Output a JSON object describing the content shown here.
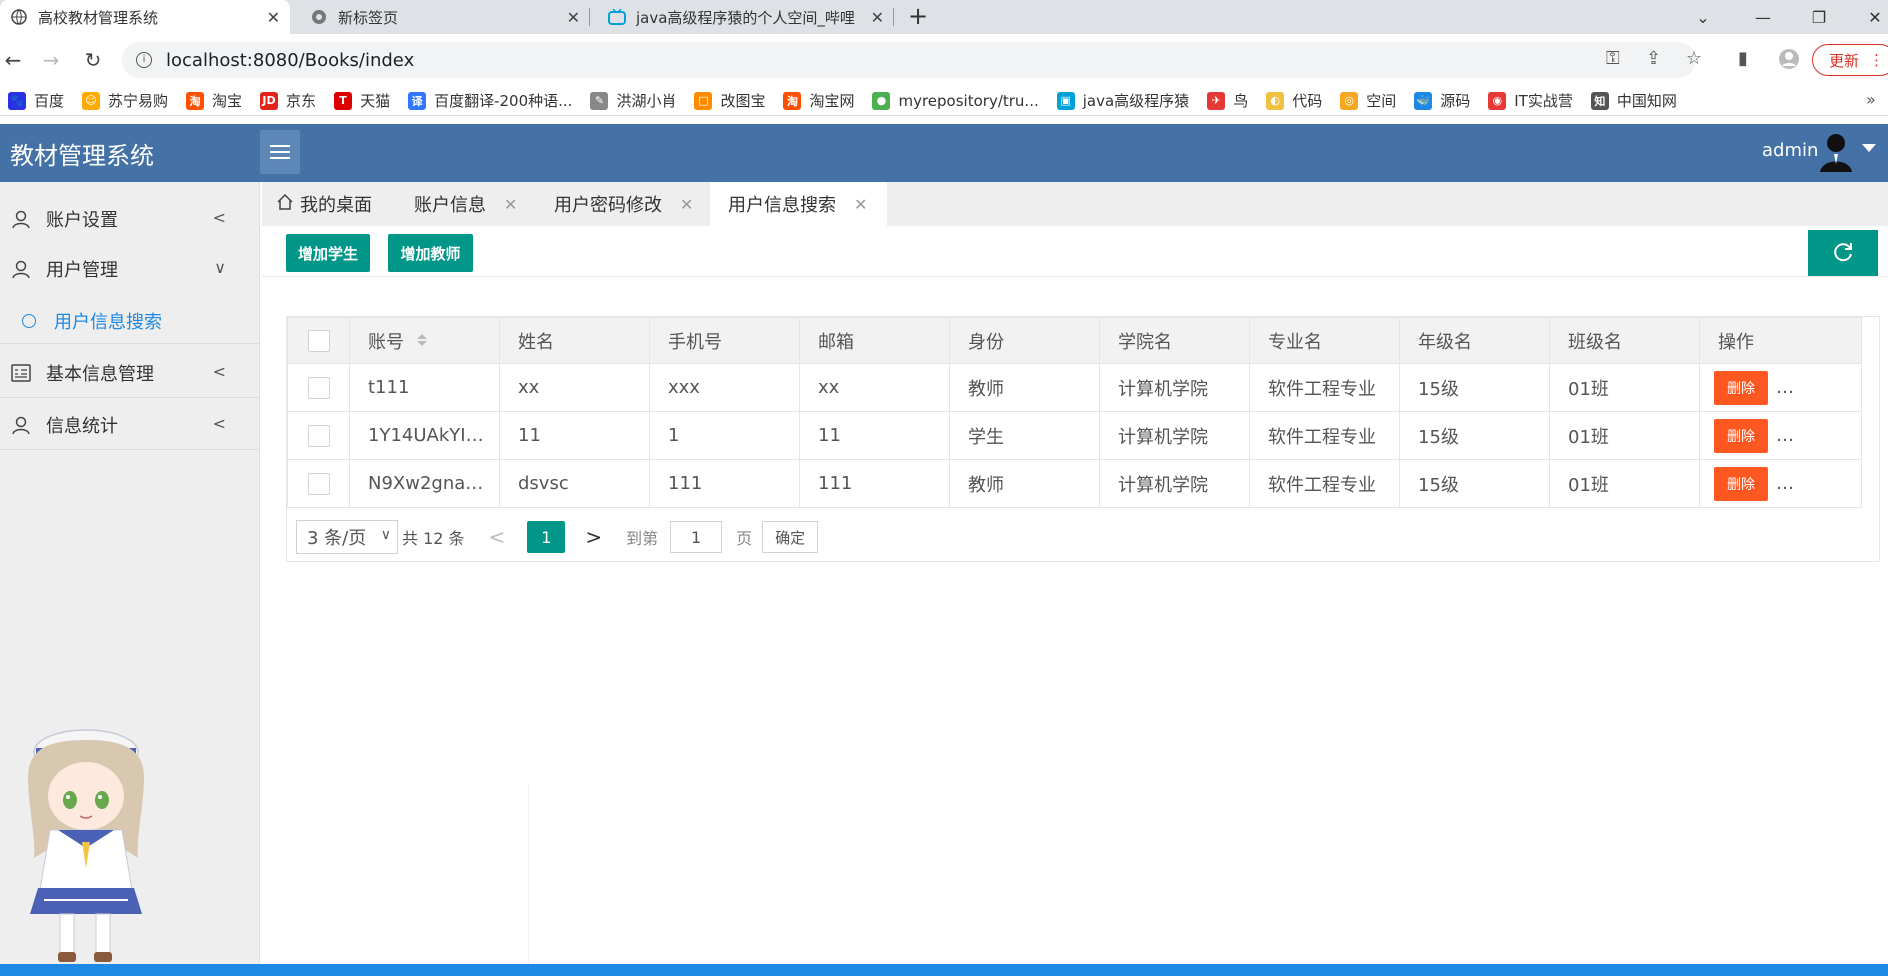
{
  "browser": {
    "tabs": [
      {
        "title": "高校教材管理系统",
        "icon": "globe-icon"
      },
      {
        "title": "新标签页",
        "icon": "chrome-icon"
      },
      {
        "title": "java高级程序猿的个人空间_哔哩",
        "icon": "bilibili-icon"
      }
    ],
    "url": "localhost:8080/Books/index",
    "update_label": "更新",
    "bookmarks": [
      {
        "label": "百度",
        "color": "#2932e1",
        "glyph": "🐾"
      },
      {
        "label": "苏宁易购",
        "color": "#ffaa00",
        "glyph": "☺"
      },
      {
        "label": "淘宝",
        "color": "#ff5000",
        "glyph": "淘"
      },
      {
        "label": "京东",
        "color": "#e1251b",
        "glyph": "JD"
      },
      {
        "label": "天猫",
        "color": "#d00",
        "glyph": "T"
      },
      {
        "label": "百度翻译-200种语...",
        "color": "#3377ff",
        "glyph": "译"
      },
      {
        "label": "洪湖小肖",
        "color": "#888",
        "glyph": "✎"
      },
      {
        "label": "改图宝",
        "color": "#ff8c00",
        "glyph": "□"
      },
      {
        "label": "淘宝网",
        "color": "#ff5000",
        "glyph": "淘"
      },
      {
        "label": "myrepository/tru...",
        "color": "#4caf50",
        "glyph": "●"
      },
      {
        "label": "java高级程序猿",
        "color": "#00a1d6",
        "glyph": "▣"
      },
      {
        "label": "鸟",
        "color": "#e53935",
        "glyph": "✈"
      },
      {
        "label": "代码",
        "color": "#f0c040",
        "glyph": "◐"
      },
      {
        "label": "空间",
        "color": "#f5a623",
        "glyph": "◎"
      },
      {
        "label": "源码",
        "color": "#1e88e5",
        "glyph": "🐳"
      },
      {
        "label": "IT实战营",
        "color": "#e53935",
        "glyph": "◉"
      },
      {
        "label": "中国知网",
        "color": "#555",
        "glyph": "知"
      }
    ]
  },
  "app": {
    "title": "教材管理系统",
    "user": "admin"
  },
  "sidebar": {
    "items": [
      {
        "label": "账户设置",
        "arrow": "<"
      },
      {
        "label": "用户管理",
        "arrow": "∨"
      },
      {
        "label": "基本信息管理",
        "arrow": "<"
      },
      {
        "label": "信息统计",
        "arrow": "<"
      }
    ],
    "sub_item": "用户信息搜索"
  },
  "content_tabs": [
    {
      "label": "我的桌面"
    },
    {
      "label": "账户信息"
    },
    {
      "label": "用户密码修改"
    },
    {
      "label": "用户信息搜索"
    }
  ],
  "toolbar": {
    "add_student": "增加学生",
    "add_teacher": "增加教师"
  },
  "table": {
    "headers": [
      "账号",
      "姓名",
      "手机号",
      "邮箱",
      "身份",
      "学院名",
      "专业名",
      "年级名",
      "班级名",
      "操作"
    ],
    "rows": [
      [
        "t111",
        "xx",
        "xxx",
        "xx",
        "教师",
        "计算机学院",
        "软件工程专业",
        "15级",
        "01班"
      ],
      [
        "1Y14UAkYI…",
        "11",
        "1",
        "11",
        "学生",
        "计算机学院",
        "软件工程专业",
        "15级",
        "01班"
      ],
      [
        "N9Xw2gna…",
        "dsvsc",
        "111",
        "111",
        "教师",
        "计算机学院",
        "软件工程专业",
        "15级",
        "01班"
      ]
    ],
    "delete_label": "删除",
    "more_label": "…"
  },
  "pager": {
    "page_size": "3 条/页",
    "total": "共 12 条",
    "current": "1",
    "goto_label": "到第",
    "goto_value": "1",
    "page_label": "页",
    "confirm": "确定"
  }
}
